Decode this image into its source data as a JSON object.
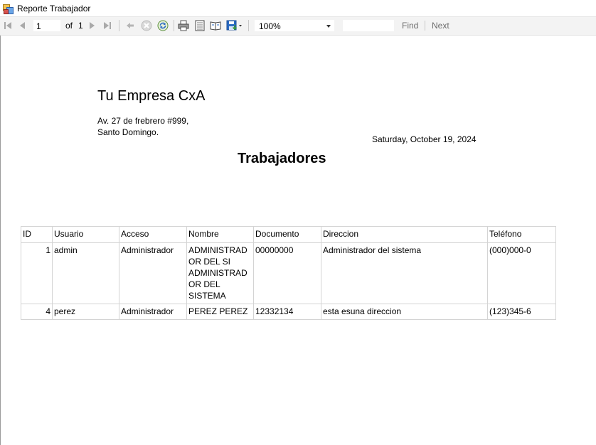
{
  "window": {
    "title": "Reporte Trabajador"
  },
  "toolbar": {
    "current_page": "1",
    "of_label": "of",
    "total_pages": "1",
    "zoom": "100%",
    "find_text": "",
    "find_label": "Find",
    "next_label": "Next",
    "icons": [
      "first-page-icon",
      "previous-page-icon",
      "next-page-icon",
      "last-page-icon",
      "back-icon",
      "stop-icon",
      "refresh-icon",
      "print-icon",
      "print-layout-icon",
      "page-setup-icon",
      "export-icon"
    ]
  },
  "report": {
    "company": "Tu Empresa CxA",
    "address_line1": "Av. 27 de frebrero #999,",
    "address_line2": "Santo Domingo.",
    "date": "Saturday, October 19, 2024",
    "heading": "Trabajadores",
    "columns": [
      "ID",
      "Usuario",
      "Acceso",
      "Nombre",
      "Documento",
      "Direccion",
      "Teléfono"
    ],
    "rows": [
      {
        "id": "1",
        "usuario": "admin",
        "acceso": "Administrador",
        "nombre": "ADMINISTRAD OR DEL SI ADMINISTRAD OR DEL SISTEMA",
        "documento": "00000000",
        "direccion": "Administrador del sistema",
        "telefono": "(000)000-0"
      },
      {
        "id": "4",
        "usuario": "perez",
        "acceso": "Administrador",
        "nombre": "PEREZ PEREZ",
        "documento": "12332134",
        "direccion": "esta esuna direccion",
        "telefono": "(123)345-6"
      }
    ]
  },
  "colors": {
    "toolbar_bg": "#f3f3f3",
    "grid_border": "#d4d4d4",
    "icon_blue": "#2b6cc4"
  }
}
